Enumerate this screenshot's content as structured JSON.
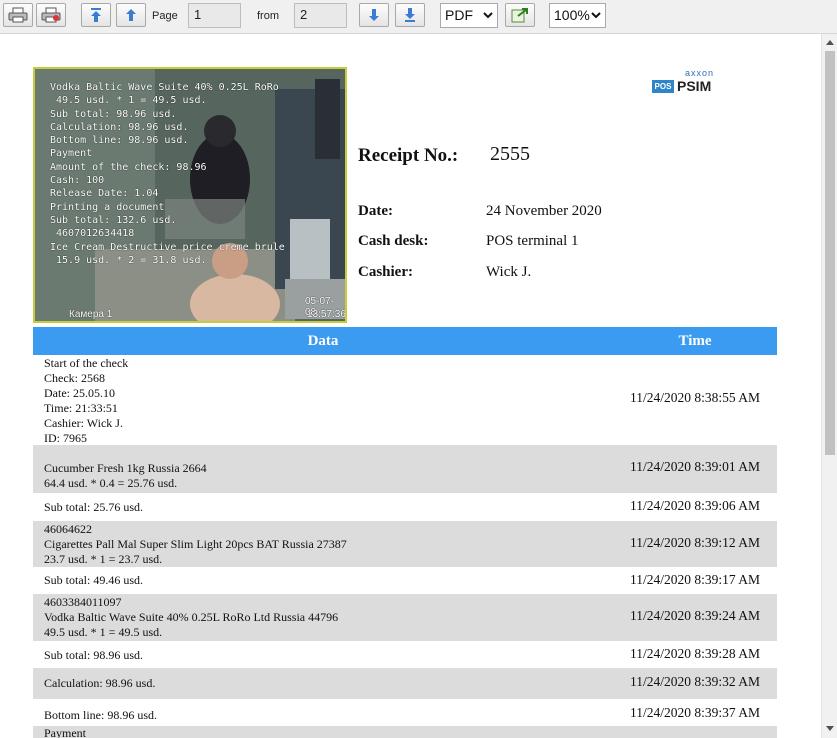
{
  "toolbar": {
    "page_label": "Page",
    "page_value": "1",
    "from_label": "from",
    "total_pages": "2",
    "format": "PDF",
    "zoom": "100%"
  },
  "camera": {
    "overlay": "Vodka Baltic Wave Suite 40% 0.25L RoRo\n 49.5 usd. * 1 = 49.5 usd.\nSub total: 98.96 usd.\nCalculation: 98.96 usd.\nBottom line: 98.96 usd.\nPayment\nAmount of the check: 98.96\nCash: 100\nRelease Date: 1.04\nPrinting a document\nSub total: 132.6 usd.\n 4607012634418\nIce Cream Destructive price creme brule\n 15.9 usd. * 2 = 31.8 usd.",
    "cam_name": "Камера 1",
    "date_stamp": "05-07-08",
    "time_stamp": "13:57:36"
  },
  "logo": {
    "brand": "axxon",
    "badge": "POS",
    "product": "PSIM"
  },
  "receipt": {
    "label": "Receipt No.:",
    "number": "2555",
    "date_label": "Date:",
    "date": "24 November 2020",
    "cashdesk_label": "Cash desk:",
    "cashdesk": "POS terminal 1",
    "cashier_label": "Cashier:",
    "cashier": "Wick J."
  },
  "table": {
    "header": {
      "data": "Data",
      "time": "Time"
    },
    "rows": [
      {
        "data": "Start of the check\nCheck: 2568\nDate: 25.05.10\nTime: 21:33:51\nCashier: Wick J.\nID: 7965",
        "time": "11/24/2020 8:38:55 AM"
      },
      {
        "data": "\nCucumber Fresh 1kg Russia 2664\n64.4 usd. * 0.4 = 25.76 usd.",
        "time": "11/24/2020 8:39:01 AM"
      },
      {
        "data": "Sub total: 25.76 usd.",
        "time": "11/24/2020 8:39:06 AM"
      },
      {
        "data": "46064622\nCigarettes Pall Mal Super Slim Light 20pcs BAT Russia 27387\n23.7 usd. * 1 = 23.7 usd.",
        "time": "11/24/2020 8:39:12 AM"
      },
      {
        "data": "Sub total: 49.46 usd.",
        "time": "11/24/2020 8:39:17 AM"
      },
      {
        "data": "4603384011097\nVodka Baltic Wave Suite 40% 0.25L RoRo Ltd Russia 44796\n49.5 usd. * 1 = 49.5 usd.",
        "time": "11/24/2020 8:39:24 AM"
      },
      {
        "data": "Sub total: 98.96 usd.",
        "time": "11/24/2020 8:39:28 AM"
      },
      {
        "data": "Calculation: 98.96 usd.",
        "time": "11/24/2020 8:39:32 AM"
      },
      {
        "data": "Bottom line: 98.96 usd.",
        "time": "11/24/2020 8:39:37 AM"
      },
      {
        "data": "Payment",
        "time": ""
      }
    ]
  }
}
